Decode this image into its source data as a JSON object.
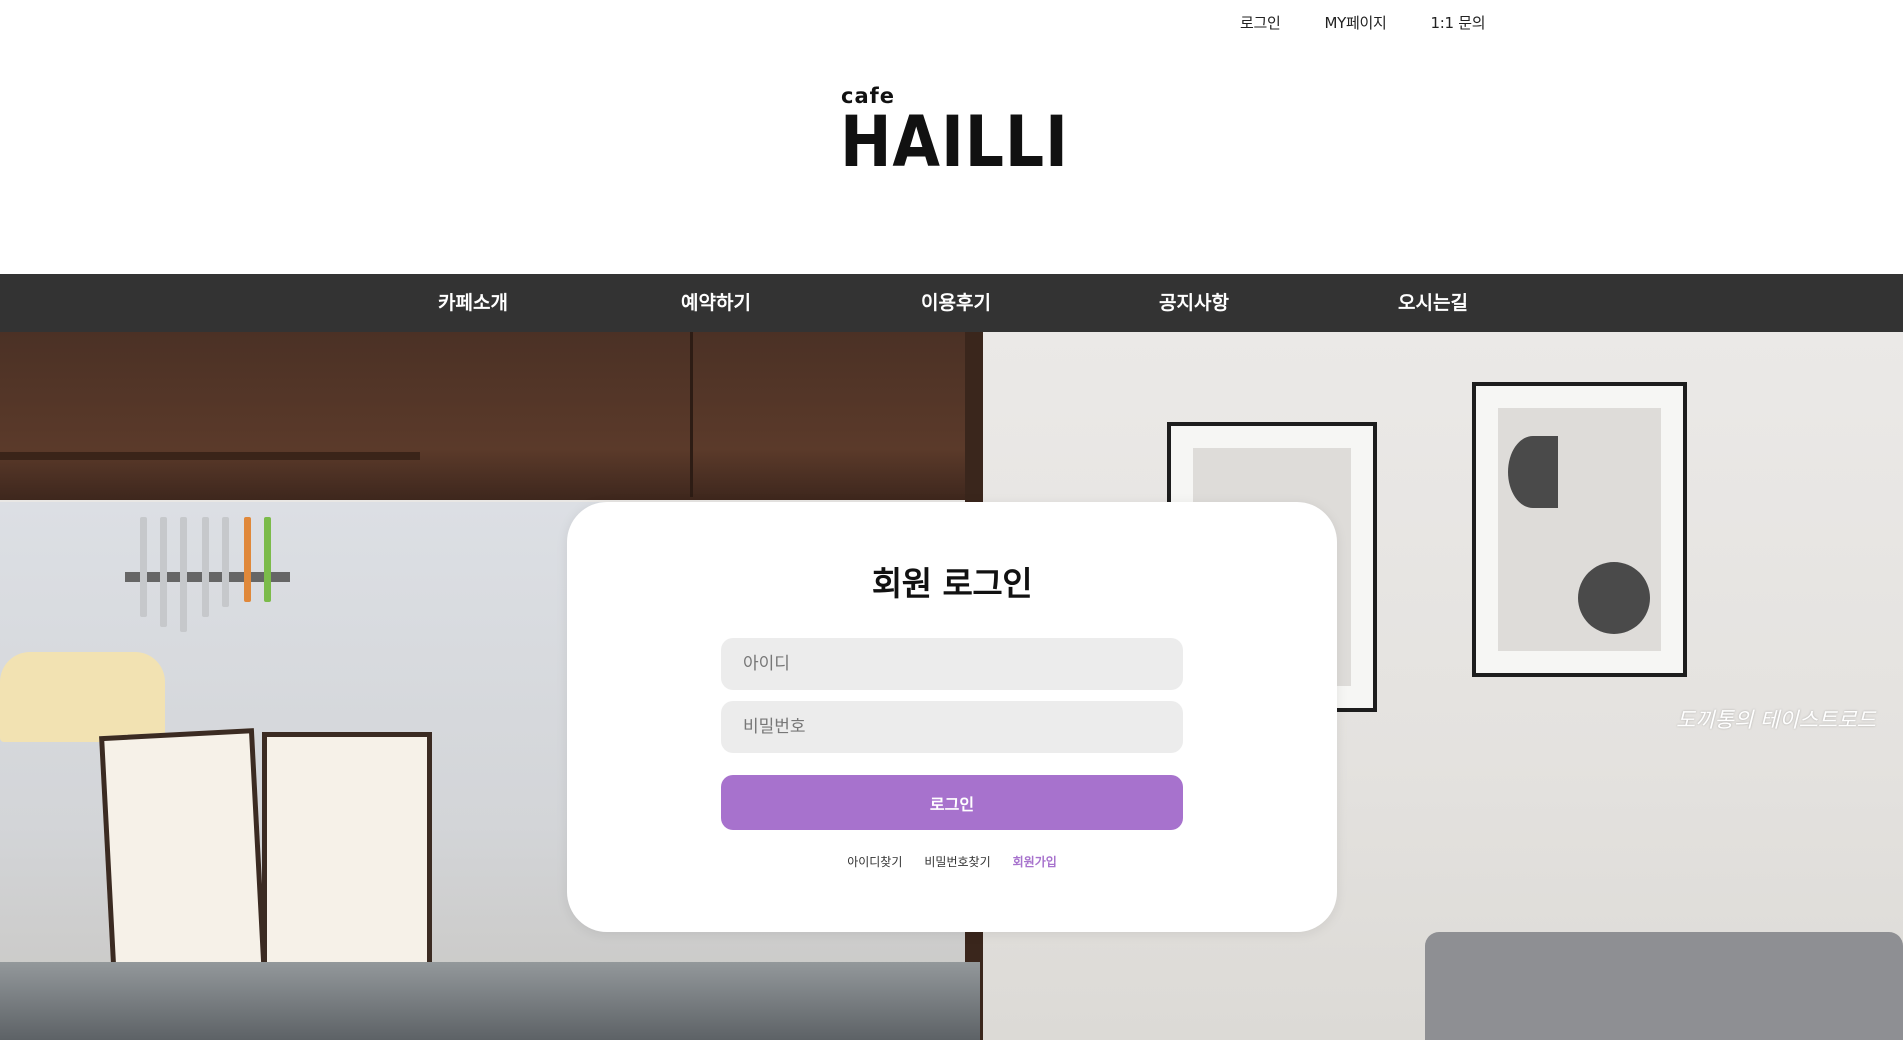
{
  "top_links": {
    "login": "로그인",
    "mypage": "MY페이지",
    "inquiry": "1:1 문의"
  },
  "logo": {
    "small": "cafe",
    "big": "HAILLI"
  },
  "nav": {
    "items": [
      "카페소개",
      "예약하기",
      "이용후기",
      "공지사항",
      "오시는길"
    ]
  },
  "hero": {
    "watermark": "도끼통의 테이스트로드"
  },
  "login": {
    "title": "회원 로그인",
    "id_placeholder": "아이디",
    "id_value": "",
    "pw_placeholder": "비밀번호",
    "pw_value": "",
    "submit_label": "로그인",
    "find_id": "아이디찾기",
    "find_pw": "비밀번호찾기",
    "signup": "회원가입"
  },
  "colors": {
    "accent": "#a772cd",
    "navbar": "#333333",
    "input_bg": "#ececec"
  }
}
